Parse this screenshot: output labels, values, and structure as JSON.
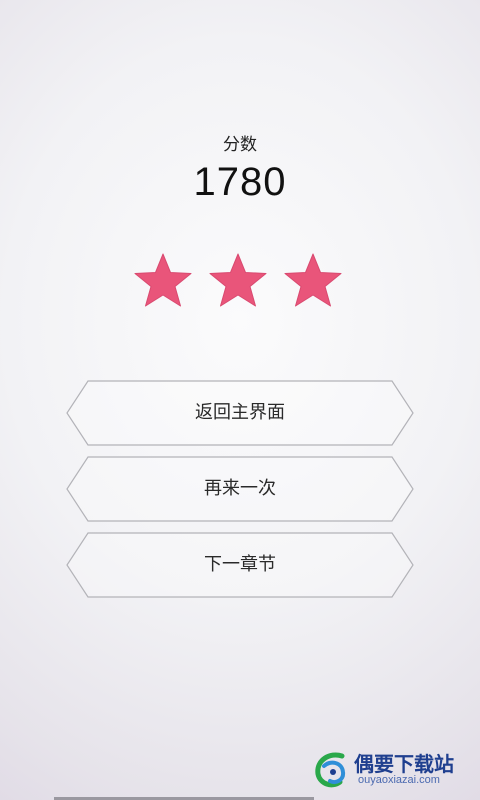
{
  "score": {
    "label": "分数",
    "value": "1780"
  },
  "rating": {
    "stars_earned": 3,
    "stars_total": 3,
    "star_color": "#e9557a"
  },
  "buttons": {
    "main_menu": "返回主界面",
    "retry": "再来一次",
    "next_chapter": "下一章节"
  },
  "watermark": {
    "title": "偶要下载站",
    "url": "ouyaoxiazai.com"
  },
  "colors": {
    "button_border": "#b3b3b8",
    "text": "#222222"
  }
}
